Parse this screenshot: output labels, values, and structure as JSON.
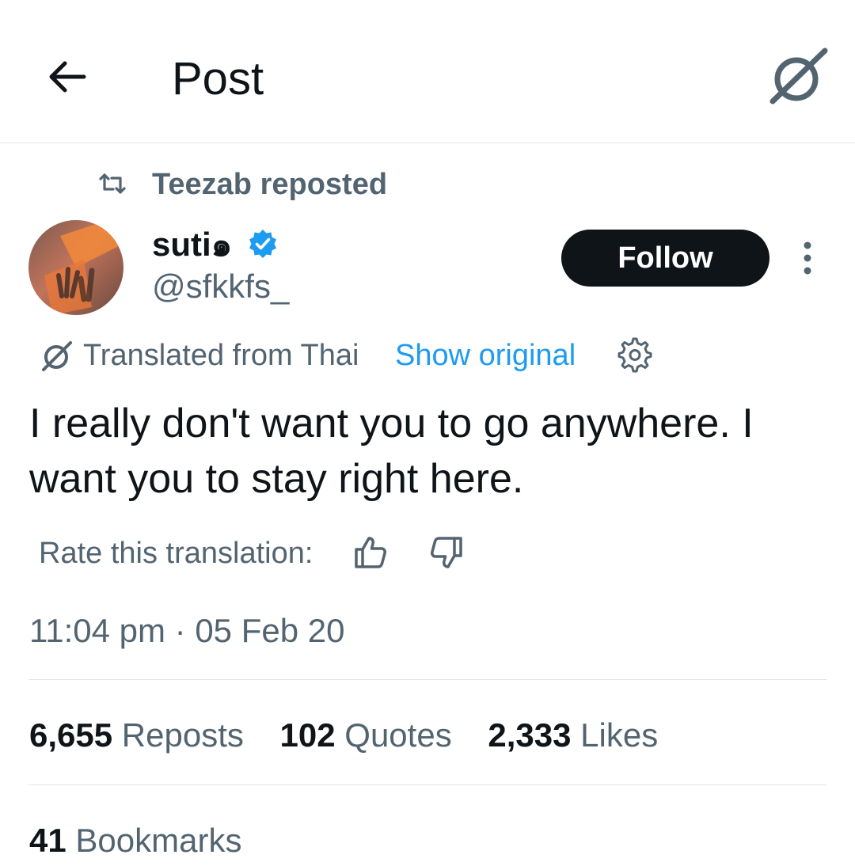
{
  "header": {
    "title": "Post",
    "back_icon": "arrow-left-icon",
    "grok_icon": "grok-icon"
  },
  "repost": {
    "text": "Teezab reposted",
    "icon": "repost-icon"
  },
  "author": {
    "display_name": "suti๑",
    "handle": "@sfkkfs_",
    "verified": true,
    "verified_color": "#1d9bf0"
  },
  "follow_label": "Follow",
  "translation": {
    "label": "Translated from Thai",
    "show_original": "Show original"
  },
  "tweet_text": "I really don't want you to go anywhere. I want you to stay right here.",
  "rate": {
    "label": "Rate this translation:"
  },
  "timestamp": "11:04 pm · 05 Feb 20",
  "stats": {
    "reposts_count": "6,655",
    "reposts_label": "Reposts",
    "quotes_count": "102",
    "quotes_label": "Quotes",
    "likes_count": "2,333",
    "likes_label": "Likes",
    "bookmarks_count": "41",
    "bookmarks_label": "Bookmarks"
  },
  "colors": {
    "accent": "#1d9bf0",
    "text_primary": "#0f1419",
    "text_secondary": "#536471",
    "follow_bg": "#0f1419"
  }
}
